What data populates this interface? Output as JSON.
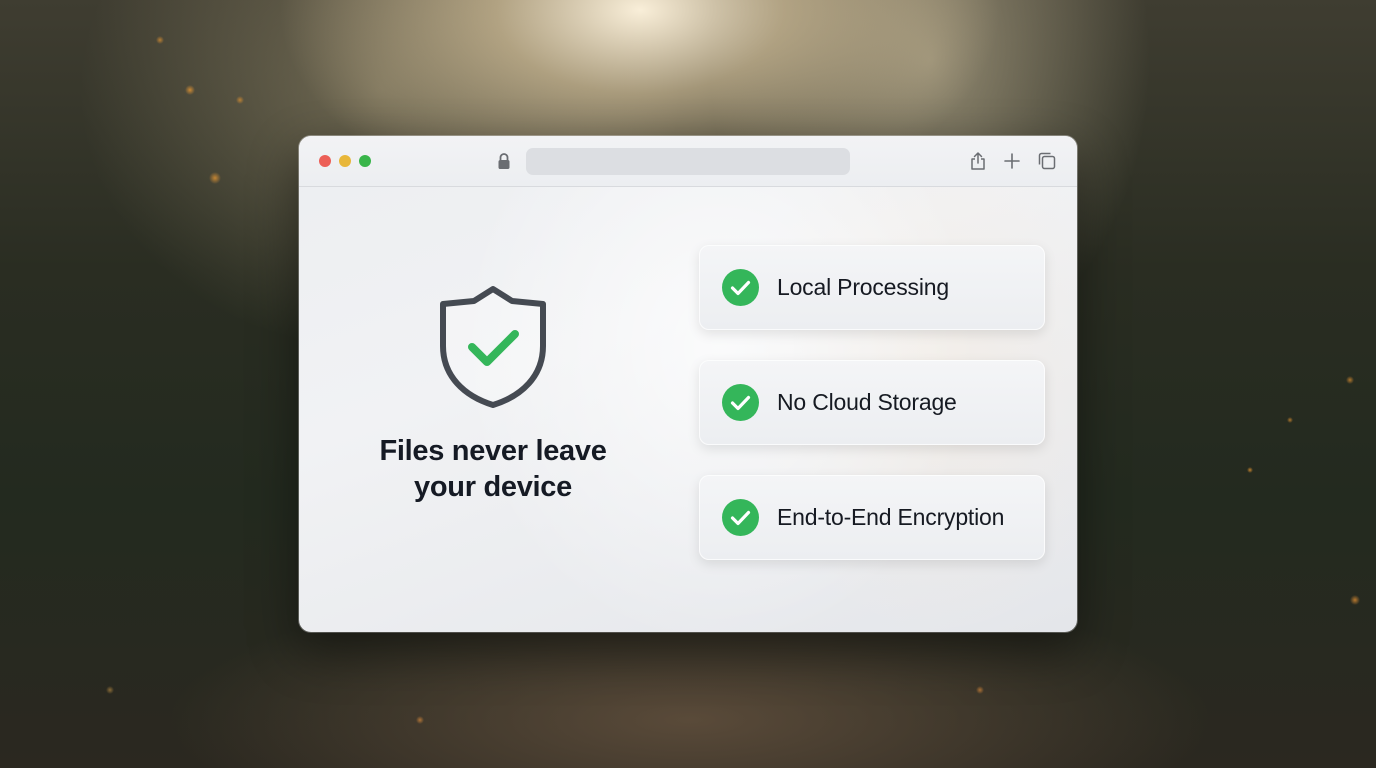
{
  "browser": {
    "address_bar": {
      "value": ""
    }
  },
  "hero": {
    "headline_line1": "Files never leave",
    "headline_line2": "your device"
  },
  "features": [
    {
      "label": "Local Processing",
      "icon": "check-circle-icon"
    },
    {
      "label": "No Cloud Storage",
      "icon": "check-circle-icon"
    },
    {
      "label": "End-to-End Encryption",
      "icon": "check-circle-icon"
    }
  ],
  "colors": {
    "accent_green": "#34b65a",
    "shield_stroke": "#454a52",
    "headline_text": "#151a24"
  }
}
